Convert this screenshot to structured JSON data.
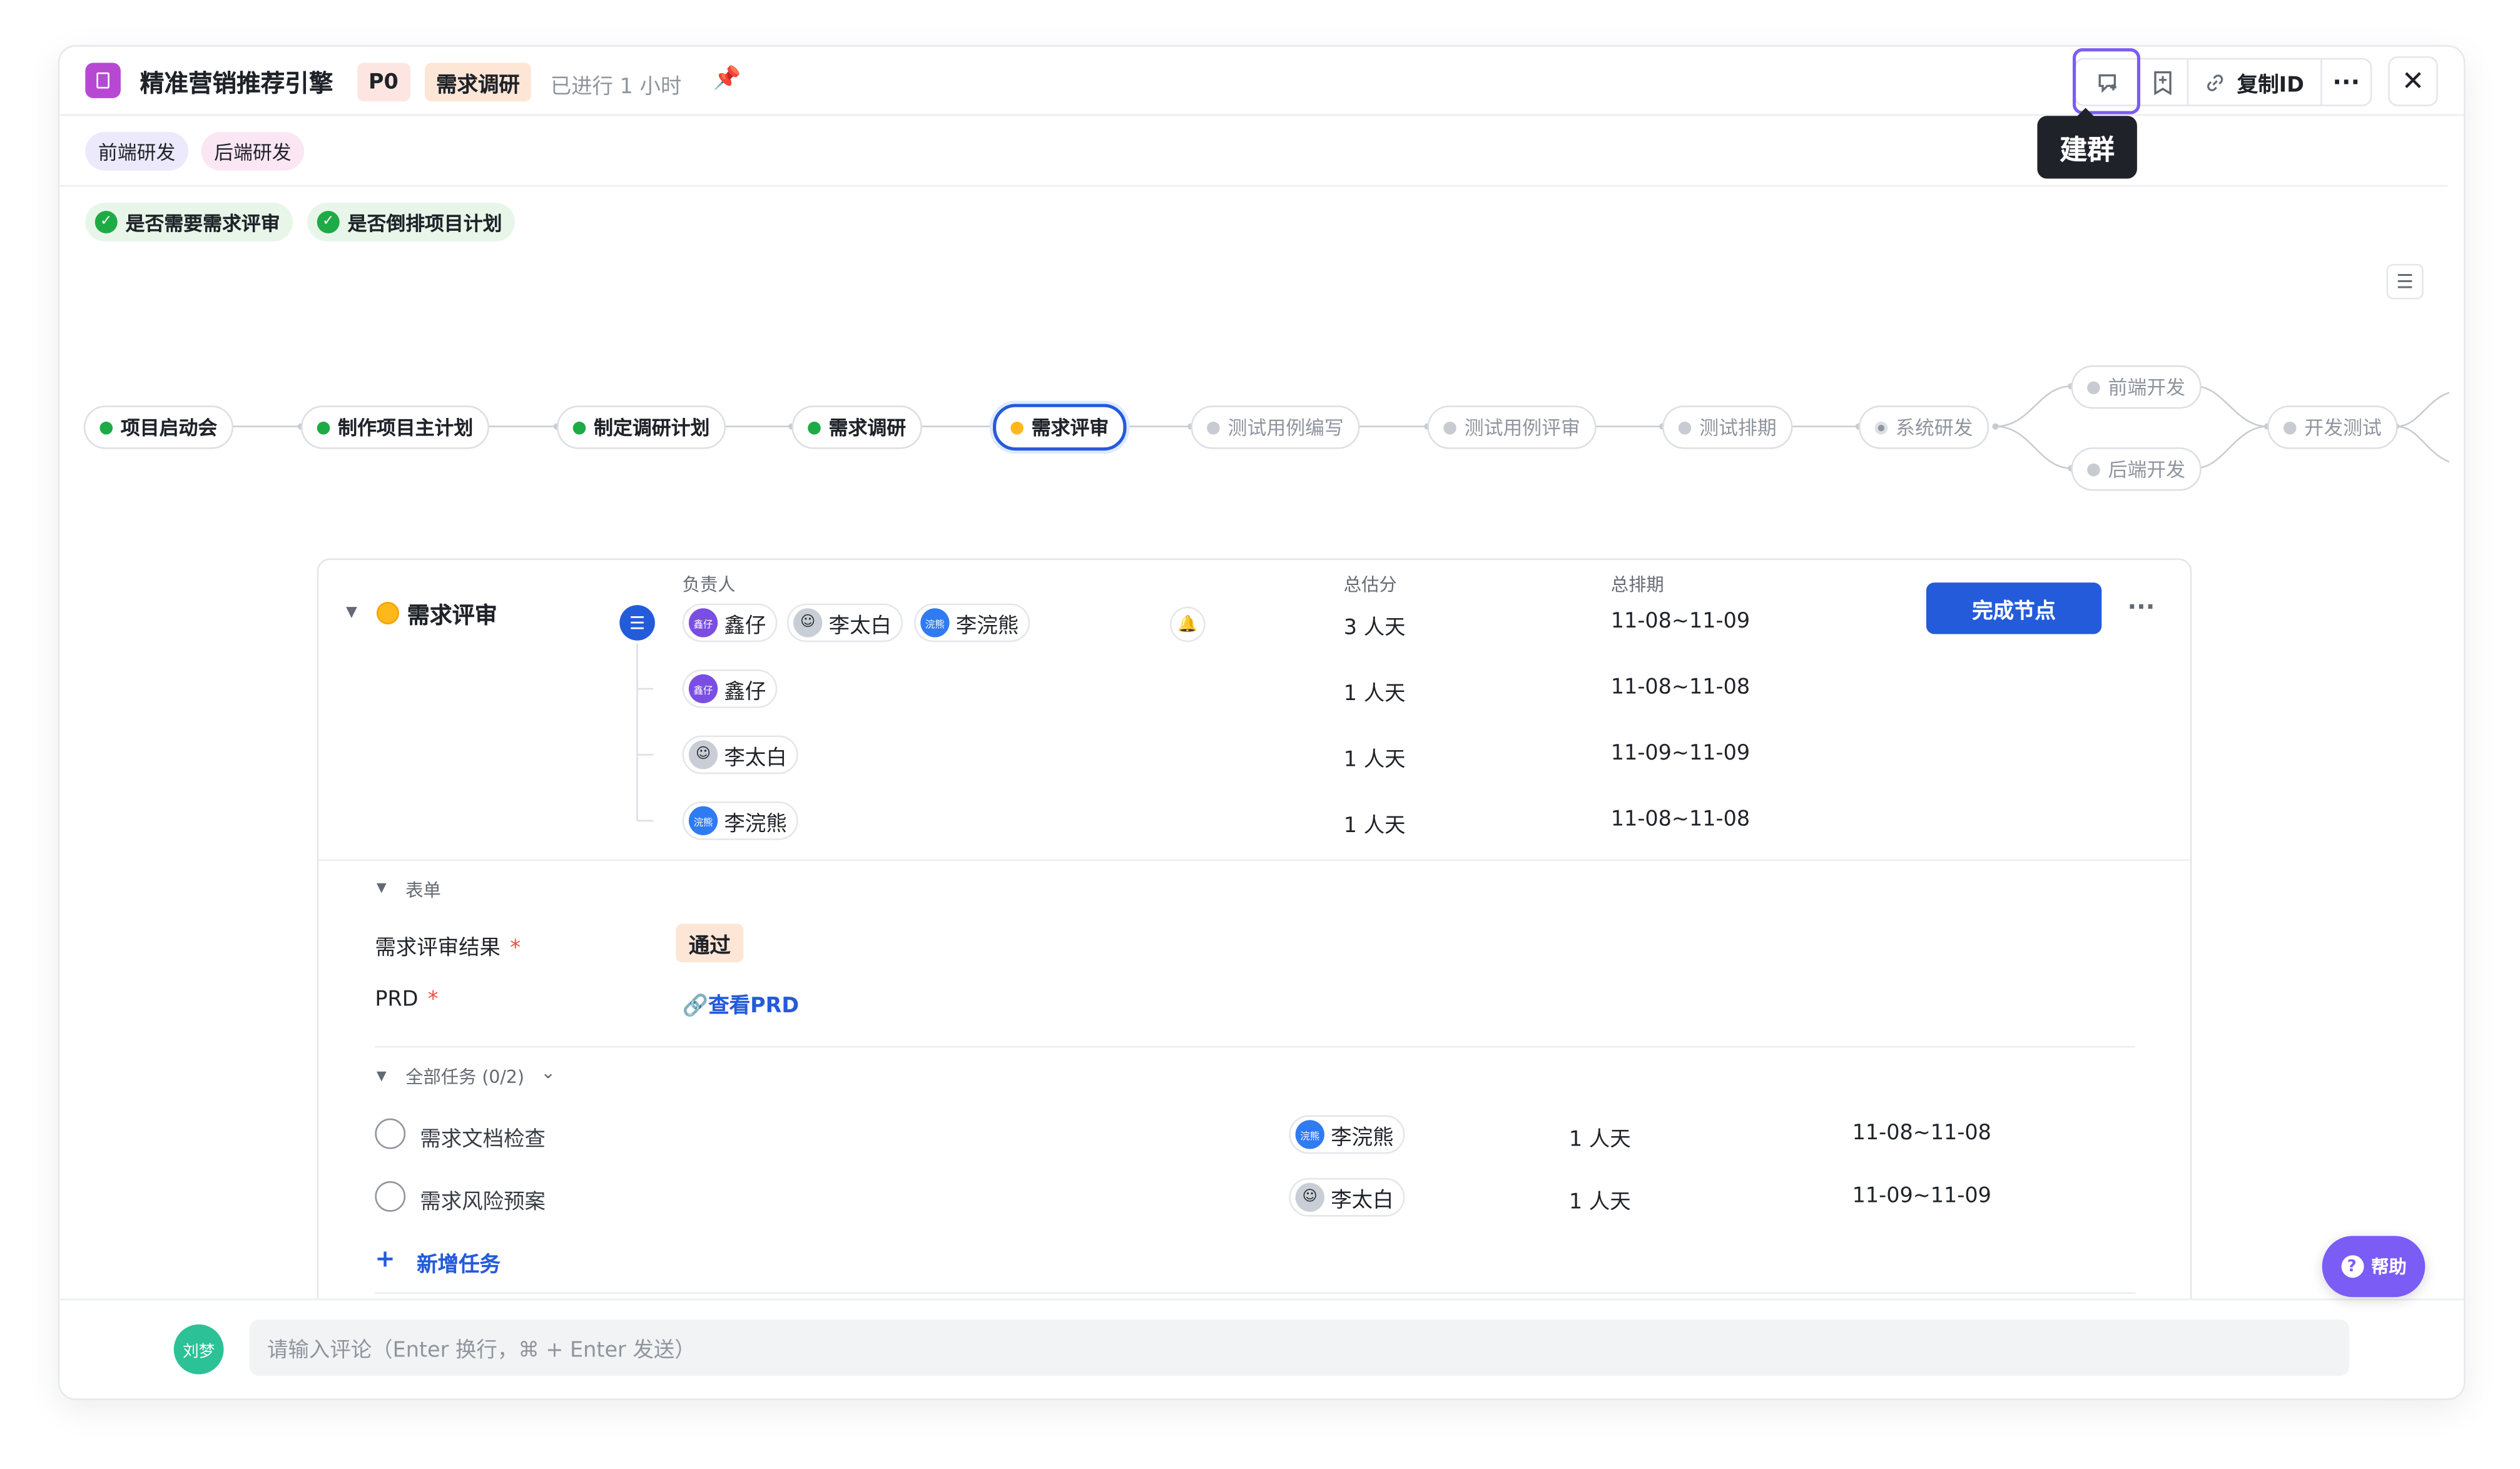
{
  "header": {
    "title": "精准营销推荐引擎",
    "priority": "P0",
    "stage": "需求调研",
    "elapsed": "已进行 1 小时",
    "copy_id_label": "复制ID",
    "tooltip": "建群"
  },
  "teams": [
    "前端研发",
    "后端研发"
  ],
  "checks": [
    "是否需要需求评审",
    "是否倒排项目计划"
  ],
  "flow": {
    "nodes": [
      {
        "label": "项目启动会",
        "status": "done"
      },
      {
        "label": "制作项目主计划",
        "status": "done"
      },
      {
        "label": "制定调研计划",
        "status": "done"
      },
      {
        "label": "需求调研",
        "status": "done"
      },
      {
        "label": "需求评审",
        "status": "current"
      },
      {
        "label": "测试用例编写",
        "status": "todo"
      },
      {
        "label": "测试用例评审",
        "status": "todo"
      },
      {
        "label": "测试排期",
        "status": "todo"
      },
      {
        "label": "系统研发",
        "status": "todo"
      },
      {
        "label": "前端开发",
        "status": "todo"
      },
      {
        "label": "后端开发",
        "status": "todo"
      },
      {
        "label": "开发测试",
        "status": "todo"
      }
    ]
  },
  "card": {
    "node_title": "需求评审",
    "col_owner": "负责人",
    "col_estimate": "总估分",
    "col_schedule": "总排期",
    "complete_button": "完成节点",
    "owners": [
      {
        "name": "鑫仔",
        "avatar_text": "鑫仔",
        "kind": "xz"
      },
      {
        "name": "李太白",
        "avatar_text": "",
        "kind": "lt"
      },
      {
        "name": "李浣熊",
        "avatar_text": "浣熊",
        "kind": "lw"
      }
    ],
    "total_estimate": "3 人天",
    "total_schedule": "11-08~11-09",
    "rows": [
      {
        "name": "鑫仔",
        "avatar_text": "鑫仔",
        "kind": "xz",
        "estimate": "1 人天",
        "schedule": "11-08~11-08"
      },
      {
        "name": "李太白",
        "avatar_text": "",
        "kind": "lt",
        "estimate": "1 人天",
        "schedule": "11-09~11-09"
      },
      {
        "name": "李浣熊",
        "avatar_text": "浣熊",
        "kind": "lw",
        "estimate": "1 人天",
        "schedule": "11-08~11-08"
      }
    ],
    "form_section": "表单",
    "form": [
      {
        "label": "需求评审结果",
        "value": "通过"
      },
      {
        "label": "PRD",
        "value": "查看PRD"
      }
    ],
    "tasks_section": "全部任务 (0/2)",
    "tasks": [
      {
        "name": "需求文档检查",
        "assignee": "李浣熊",
        "avatar_text": "浣熊",
        "kind": "lw",
        "estimate": "1 人天",
        "schedule": "11-08~11-08"
      },
      {
        "name": "需求风险预案",
        "assignee": "李太白",
        "avatar_text": "",
        "kind": "lt",
        "estimate": "1 人天",
        "schedule": "11-09~11-09"
      }
    ],
    "add_task": "新增任务"
  },
  "comment": {
    "user": "刘梦",
    "placeholder": "请输入评论（Enter 换行，⌘ + Enter 发送）"
  },
  "help_label": "帮助",
  "colors": {
    "primary": "#245bdb",
    "done": "#1eaa44",
    "current": "#ffb81c",
    "accent": "#7b5cf5"
  }
}
